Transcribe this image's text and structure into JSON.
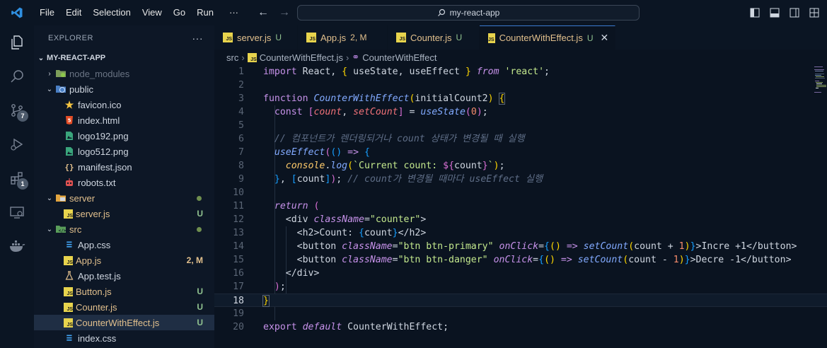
{
  "titlebar": {
    "menu": [
      "File",
      "Edit",
      "Selection",
      "View",
      "Go",
      "Run",
      "···"
    ],
    "search_text": "my-react-app"
  },
  "activity": {
    "scm_badge": "7",
    "extensions_badge": "1"
  },
  "sidebar": {
    "title": "EXPLORER",
    "more": "···",
    "root": "MY-REACT-APP",
    "items": [
      {
        "label": "node_modules",
        "status": ""
      },
      {
        "label": "public",
        "status": ""
      },
      {
        "label": "favicon.ico",
        "status": ""
      },
      {
        "label": "index.html",
        "status": ""
      },
      {
        "label": "logo192.png",
        "status": ""
      },
      {
        "label": "logo512.png",
        "status": ""
      },
      {
        "label": "manifest.json",
        "status": ""
      },
      {
        "label": "robots.txt",
        "status": ""
      },
      {
        "label": "server",
        "status": ""
      },
      {
        "label": "server.js",
        "status": "U"
      },
      {
        "label": "src",
        "status": ""
      },
      {
        "label": "App.css",
        "status": ""
      },
      {
        "label": "App.js",
        "status": "2, M"
      },
      {
        "label": "App.test.js",
        "status": ""
      },
      {
        "label": "Button.js",
        "status": "U"
      },
      {
        "label": "Counter.js",
        "status": "U"
      },
      {
        "label": "CounterWithEffect.js",
        "status": "U"
      },
      {
        "label": "index.css",
        "status": ""
      }
    ]
  },
  "tabs": [
    {
      "label": "server.js",
      "status": "U"
    },
    {
      "label": "App.js",
      "status": "2, M"
    },
    {
      "label": "Counter.js",
      "status": "U"
    },
    {
      "label": "CounterWithEffect.js",
      "status": "U"
    }
  ],
  "breadcrumb": {
    "folder": "src",
    "file": "CounterWithEffect.js",
    "symbol": "CounterWithEffect"
  },
  "editor": {
    "line_numbers": [
      "1",
      "2",
      "3",
      "4",
      "5",
      "6",
      "7",
      "8",
      "9",
      "10",
      "11",
      "12",
      "13",
      "14",
      "15",
      "16",
      "17",
      "18",
      "19",
      "20"
    ],
    "current_line": "18",
    "t": {
      "l1a": "import",
      "l1b": " React, ",
      "l1c": "{",
      "l1d": " useState, useEffect ",
      "l1e": "}",
      "l1f": " from",
      "l1g": " 'react'",
      "l1h": ";",
      "l3a": "function",
      "l3b": " CounterWithEffect",
      "l3c": "(",
      "l3d": "initialCount2",
      "l3e": ")",
      "l3f": " ",
      "l3g": "{",
      "l4a": "  const ",
      "l4b": "[",
      "l4c": "count",
      "l4d": ", ",
      "l4e": "setCount",
      "l4f": "]",
      "l4g": " = ",
      "l4h": "useState",
      "l4i": "(",
      "l4j": "0",
      "l4k": ")",
      "l4l": ";",
      "l6": "  // 컴포넌트가 렌더링되거나 count 상태가 변경될 때 실행",
      "l7a": "  ",
      "l7b": "useEffect",
      "l7c": "(",
      "l7d": "()",
      "l7e": " => ",
      "l7f": "{",
      "l8a": "    ",
      "l8b": "console",
      "l8c": ".",
      "l8d": "log",
      "l8e": "(",
      "l8f": "`Current count: ",
      "l8g": "${",
      "l8h": "count",
      "l8i": "}",
      "l8j": "`",
      "l8k": ")",
      "l8l": ";",
      "l9a": "  ",
      "l9b": "}",
      "l9c": ", ",
      "l9d": "[",
      "l9e": "count",
      "l9f": "]",
      "l9g": ")",
      "l9h": ";",
      "l9i": " // count가 변경될 때마다 useEffect 실행",
      "l11a": "  ",
      "l11b": "return",
      "l11c": " (",
      "l12a": "    <div ",
      "l12b": "className",
      "l12c": "=",
      "l12d": "\"counter\"",
      "l12e": ">",
      "l13a": "      <h2>Count: ",
      "l13b": "{",
      "l13c": "count",
      "l13d": "}",
      "l13e": "</h2>",
      "l14a": "      <button ",
      "l14b": "className",
      "l14c": "=",
      "l14d": "\"btn btn-primary\"",
      "l14e": " ",
      "l14f": "onClick",
      "l14g": "=",
      "l14h": "{",
      "l14i": "()",
      "l14j": " => ",
      "l14k": "setCount",
      "l14l": "(",
      "l14m": "count + ",
      "l14n": "1",
      "l14o": ")",
      "l14p": "}",
      "l14q": ">Incre +1</button>",
      "l15a": "      <button ",
      "l15b": "className",
      "l15c": "=",
      "l15d": "\"btn btn-danger\"",
      "l15e": " ",
      "l15f": "onClick",
      "l15g": "=",
      "l15h": "{",
      "l15i": "()",
      "l15j": " => ",
      "l15k": "setCount",
      "l15l": "(",
      "l15m": "count - ",
      "l15n": "1",
      "l15o": ")",
      "l15p": "}",
      "l15q": ">Decre -1</button>",
      "l16": "    </div>",
      "l17a": "  ",
      "l17b": ")",
      "l17c": ";",
      "l18": "}",
      "l20a": "export",
      "l20b": " default",
      "l20c": " CounterWithEffect;"
    }
  }
}
